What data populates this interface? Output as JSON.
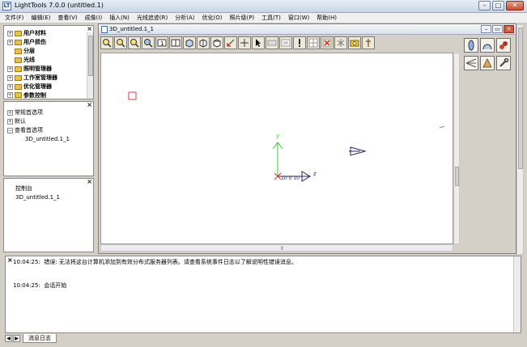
{
  "window": {
    "app_icon": "LT",
    "title": "LightTools 7.0.0  (untitled.1)",
    "buttons": [
      "minimize",
      "maximize",
      "close"
    ]
  },
  "menu": [
    "文件(F)",
    "编辑(E)",
    "查看(V)",
    "成像(I)",
    "插入(N)",
    "光线追迹(R)",
    "分析(A)",
    "优化(O)",
    "照片级(P)",
    "工具(T)",
    "窗口(W)",
    "帮助(H)"
  ],
  "tree_panel_1": {
    "items": [
      {
        "label": "用户材料"
      },
      {
        "label": "用户损伤"
      },
      {
        "label": "分层"
      },
      {
        "label": "光线"
      },
      {
        "label": "照明管理器"
      },
      {
        "label": "工作室管理器"
      },
      {
        "label": "优化管理器"
      },
      {
        "label": "参数控制"
      }
    ]
  },
  "tree_panel_2": {
    "items": [
      {
        "label": "常规首选项"
      },
      {
        "label": "默认"
      },
      {
        "label": "查看首选项"
      },
      {
        "label": "3D_untitled.1_1"
      }
    ]
  },
  "tree_panel_3": {
    "items": [
      {
        "label": "控制台"
      },
      {
        "label": "3D_untitled.1_1"
      }
    ]
  },
  "document": {
    "title": "3D_untitled.1_1",
    "axis_labels": {
      "y": "y",
      "z": "z",
      "scale": "10  0  10"
    }
  },
  "toolbar_icons": [
    "zoom-in-icon",
    "zoom-out-icon",
    "zoom-window-icon",
    "fit-icon",
    "view-1-icon",
    "view-2-icon",
    "iso-view-icon",
    "front-view-icon",
    "side-view-icon",
    "rotate-icon",
    "pan-icon",
    "select-icon",
    "dim-icon",
    "list-icon",
    "info-icon",
    "grid-icon",
    "light-icon",
    "spectrum-icon",
    "probe-icon",
    "sensor-icon"
  ],
  "right_tools": [
    "lens-icon",
    "mirror-icon",
    "solid-icon",
    "ray-fan-icon",
    "prism-icon",
    "wrench-icon"
  ],
  "messages": [
    {
      "time": "10:04:25:",
      "text": "错误: 无法将这台计算机添加到有效分布式服务器列表。请查看系统事件日志以了解说明性错误消息。"
    },
    {
      "time": "10:04:25:",
      "text": "会话开始"
    }
  ],
  "message_tab": "消息日志"
}
